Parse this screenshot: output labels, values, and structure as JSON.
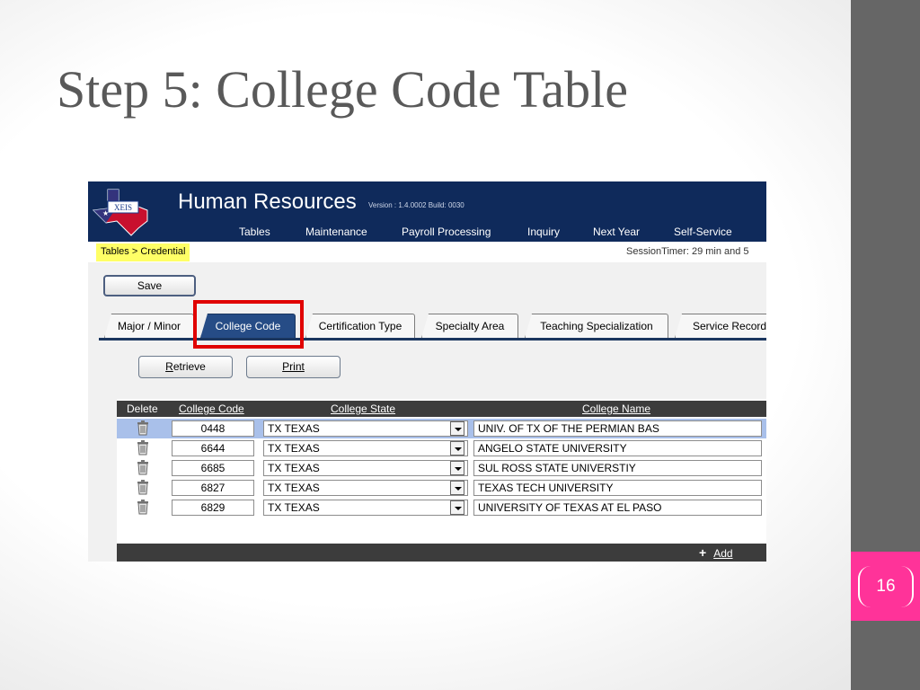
{
  "slide": {
    "title": "Step 5: College Code Table",
    "number": "16"
  },
  "app": {
    "logo_text": "XEIS",
    "title": "Human Resources",
    "version": "Version : 1.4.0002 Build: 0030",
    "nav": [
      "Tables",
      "Maintenance",
      "Payroll Processing",
      "Inquiry",
      "Next Year",
      "Self-Service"
    ],
    "breadcrumb": "Tables > Credential",
    "session_timer": "SessionTimer: 29 min and 5",
    "save_label": "Save",
    "tabs": [
      "Major / Minor",
      "College Code",
      "Certification Type",
      "Specialty Area",
      "Teaching Specialization",
      "Service Record"
    ],
    "active_tab": "College Code",
    "retrieve_label": "Retrieve",
    "print_label": "Print",
    "grid": {
      "columns": {
        "delete": "Delete",
        "code": "College Code",
        "state": "College State",
        "name": "College Name"
      },
      "rows": [
        {
          "code": "0448",
          "state": "TX TEXAS",
          "name": "UNIV. OF TX OF THE PERMIAN BAS"
        },
        {
          "code": "6644",
          "state": "TX TEXAS",
          "name": "ANGELO STATE UNIVERSITY"
        },
        {
          "code": "6685",
          "state": "TX TEXAS",
          "name": "SUL ROSS STATE UNIVERSTIY"
        },
        {
          "code": "6827",
          "state": "TX TEXAS",
          "name": "TEXAS TECH UNIVERSITY"
        },
        {
          "code": "6829",
          "state": "TX TEXAS",
          "name": "UNIVERSITY OF TEXAS AT EL PASO"
        }
      ]
    },
    "add_label": "Add",
    "icons": {
      "delete": "trash-icon",
      "add": "plus-icon",
      "dropdown": "dropdown-arrow-icon",
      "logo": "texas-map-logo"
    }
  },
  "colors": {
    "header": "#0f2a5b",
    "active_tab": "#264c86",
    "highlight": "#e00000",
    "side_bar": "#666666",
    "slide_num": "#ff3399",
    "breadcrumb_bg": "#ffff66",
    "selected_row": "#a9c0ea"
  }
}
